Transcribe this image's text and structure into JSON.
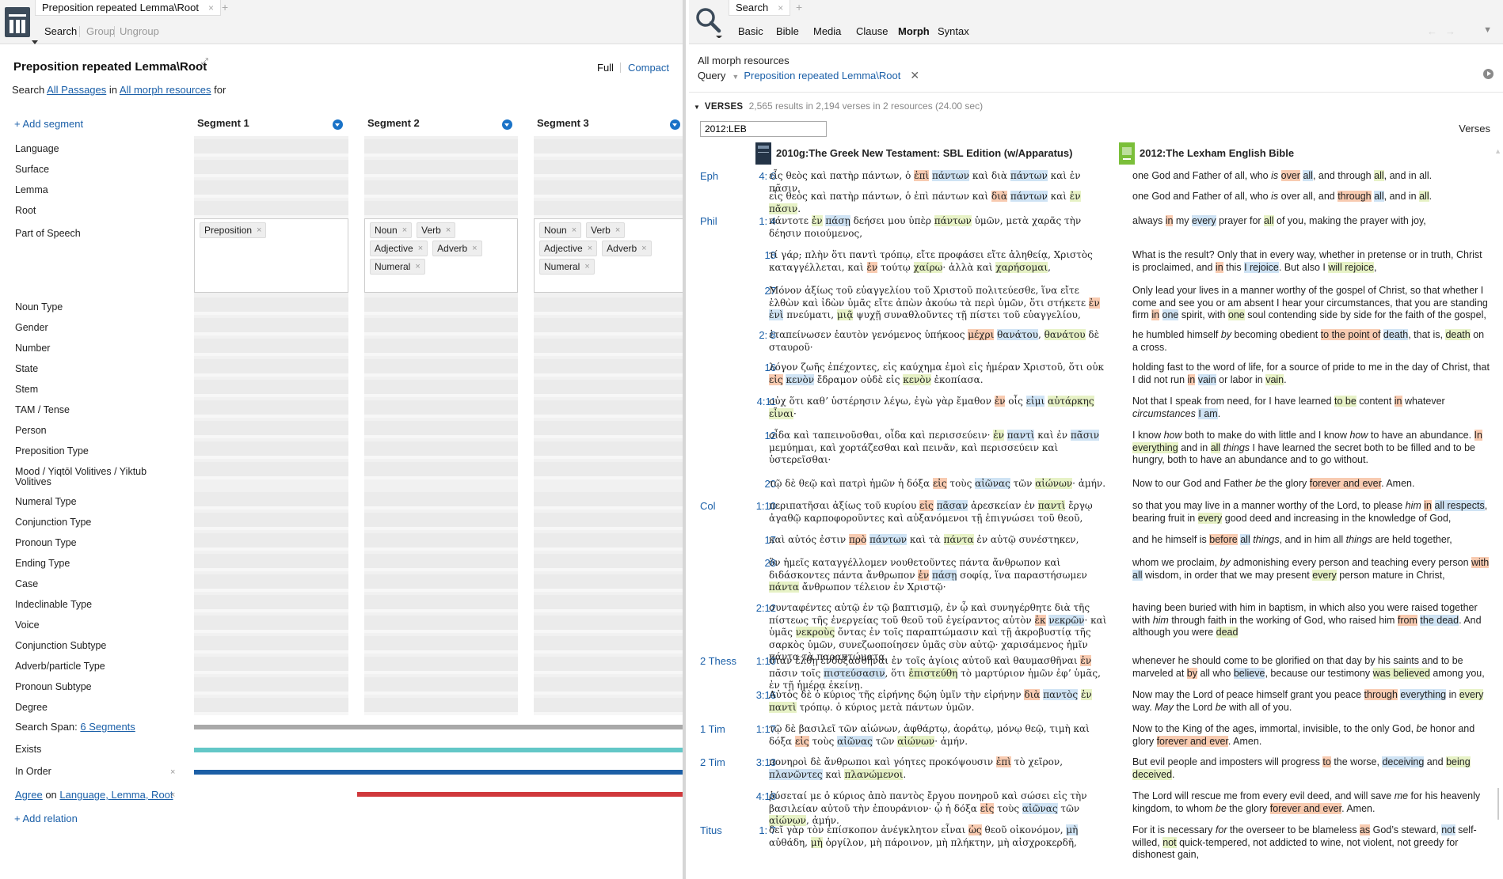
{
  "left": {
    "tab": {
      "title": "Preposition repeated Lemma\\Root",
      "close": "×",
      "plus": "+"
    },
    "toolbar": {
      "search": "Search",
      "group": "Group",
      "ungroup": "Ungroup"
    },
    "form": {
      "title": "Preposition repeated Lemma\\Root",
      "pin": "⤢",
      "view_full": "Full",
      "view_compact": "Compact",
      "search_word": "Search",
      "passages": "All Passages",
      "in_word": "in",
      "resources": "All morph resources",
      "for_word": "for",
      "add_segment": "+ Add segment"
    },
    "fields": [
      "Language",
      "Surface",
      "Lemma",
      "Root",
      "Part of Speech",
      "Noun Type",
      "Gender",
      "Number",
      "State",
      "Stem",
      "TAM / Tense",
      "Person",
      "Preposition Type",
      "Mood / Yiqtōl Volitives / Yiktub Volitives",
      "Numeral Type",
      "Conjunction Type",
      "Pronoun Type",
      "Ending Type",
      "Case",
      "Indeclinable Type",
      "Voice",
      "Conjunction Subtype",
      "Adverb/particle Type",
      "Pronoun Subtype",
      "Degree"
    ],
    "segments": [
      {
        "name": "Segment 1",
        "pos": [
          "Preposition"
        ]
      },
      {
        "name": "Segment 2",
        "pos": [
          "Noun",
          "Verb",
          "Adjective",
          "Adverb",
          "Numeral"
        ]
      },
      {
        "name": "Segment 3",
        "pos": [
          "Noun",
          "Verb",
          "Adjective",
          "Adverb",
          "Numeral"
        ]
      }
    ],
    "chip_x": "×",
    "relations": {
      "span_label": "Search Span:",
      "span_value": "6 Segments",
      "exists": "Exists",
      "in_order": "In Order",
      "agree": "Agree",
      "agree_on": "on",
      "agree_fields": "Language, Lemma, Root",
      "x": "×",
      "add_relation": "+ Add relation"
    },
    "colors": {
      "span": "#a9a9a9",
      "exists": "#63c7c7",
      "in_order": "#1c5fa6",
      "agree": "#d0393c"
    }
  },
  "right": {
    "tab": {
      "title": "Search",
      "close": "×",
      "plus": "+"
    },
    "tabs": [
      "Basic",
      "Bible",
      "Media",
      "Clause",
      "Morph",
      "Syntax"
    ],
    "active_tab": "Morph",
    "nav": {
      "back": "←",
      "forward": "→",
      "menu": "▼"
    },
    "scope": "All morph resources",
    "query_label": "Query",
    "query_dd": "▼",
    "query_name": "Preposition repeated Lemma\\Root",
    "query_x": "✕",
    "verses_tri": "▼",
    "verses_label": "VERSES",
    "results_meta": "2,565 results in 2,194 verses in 2 resources (24.00 sec)",
    "ref_input": "2012:LEB",
    "view_label": "Verses",
    "resources": [
      "2010g:The Greek New Testament: SBL Edition (w/Apparatus)",
      "2012:The Lexham English Bible"
    ],
    "rows": [
      {
        "book": "Eph",
        "ref": "4: 6",
        "gk": "εἷς θεὸς καὶ πατὴρ πάντων, ὁ [o:ἐπὶ] [b:πάντων] καὶ διὰ [b:πάντων] καὶ ἐν πᾶσιν.",
        "en": "one God and Father of all, who [i:is] [o:over] [b:all], and through [g:all], and in all."
      },
      {
        "book": "",
        "ref": "",
        "gk": "εἷς θεὸς καὶ πατὴρ πάντων, ὁ ἐπὶ πάντων καὶ [o:διὰ] [b:πάντων] καὶ [g:ἐν] [g:πᾶσιν].",
        "en": "one God and Father of all, who [i:is] over all, and [o:through] [b:all], and in [g:all]."
      },
      {
        "book": "Phil",
        "ref": "1: 4",
        "gk": "πάντοτε [g:ἐν] [b:πάσῃ] δεήσει μου ὑπὲρ [g:πάντων] ὑμῶν, μετὰ χαρᾶς τὴν δέησιν ποιούμενος,",
        "en": "always [o:in] my [b:every] prayer for [g:all] of you, making the prayer with joy,"
      },
      {
        "book": "",
        "ref": "18",
        "gk": "τί γάρ; πλὴν ὅτι παντὶ τρόπῳ, εἴτε προφάσει εἴτε ἀληθείᾳ, Χριστὸς καταγγέλλεται, καὶ [o:ἐν] τούτῳ [g:χαίρω]· ἀλλὰ καὶ [g:χαρήσομαι],",
        "en": "What is the result? Only that in every way, whether in pretense or in truth, Christ is proclaimed, and [o:in] this [b:I rejoice]. But also I [g:will rejoice],"
      },
      {
        "book": "",
        "ref": "27",
        "gk": "Μόνον ἀξίως τοῦ εὐαγγελίου τοῦ Χριστοῦ πολιτεύεσθε, ἵνα εἴτε ἐλθὼν καὶ ἰδὼν ὑμᾶς εἴτε ἀπὼν ἀκούω τὰ περὶ ὑμῶν, ὅτι στήκετε [o:ἐν] [b:ἑνὶ] πνεύματι, [g:μιᾷ] ψυχῇ συναθλοῦντες τῇ πίστει τοῦ εὐαγγελίου,",
        "en": "Only lead your lives in a manner worthy of the gospel of Christ, so that whether I come and see you or am absent I hear your circumstances, that you are standing firm [o:in] [b:one] spirit, with [g:one] soul contending side by side for the faith of the gospel,"
      },
      {
        "book": "",
        "ref": "2: 8",
        "gk": "ἐταπείνωσεν ἑαυτὸν γενόμενος ὑπήκοος [o:μέχρι] [b:θανάτου], [g:θανάτου] δὲ σταυροῦ·",
        "en": "he humbled himself [i:by] becoming obedient [o:to the point of] [b:death], that is, [g:death] on a cross."
      },
      {
        "book": "",
        "ref": "16",
        "gk": "λόγον ζωῆς ἐπέχοντες, εἰς καύχημα ἐμοὶ εἰς ἡμέραν Χριστοῦ, ὅτι οὐκ [o:εἰς] [b:κενὸν] ἔδραμον οὐδὲ εἰς [g:κενὸν] ἐκοπίασα.",
        "en": "holding fast to the word of life, for a source of pride to me in the day of Christ, that I did not run [o:in] [b:vain] or labor in [g:vain]."
      },
      {
        "book": "",
        "ref": "4:11",
        "gk": "οὐχ ὅτι καθʼ ὑστέρησιν λέγω, ἐγὼ γὰρ ἔμαθον [o:ἐν] οἷς [b:εἰμι] [g:αὐτάρκης] [g:εἶναι]·",
        "en": "Not that I speak from need, for I have learned [g:to be] content [o:in] whatever [i:circumstances] [b:I am]."
      },
      {
        "book": "",
        "ref": "12",
        "gk": "οἶδα καὶ ταπεινοῦσθαι, οἶδα καὶ περισσεύειν· [g:ἐν] [b:παντὶ] καὶ ἐν [b:πᾶσιν] μεμύημαι, καὶ χορτάζεσθαι καὶ πεινᾶν, καὶ περισσεύειν καὶ ὑστερεῖσθαι·",
        "en": "I know [i:how] both to make do with little and I know [i:how] to have an abundance. [o:In] [g:everything] and in [g:all] [i:things] I have learned the secret both to be filled and to be hungry, both to have an abundance and to go without."
      },
      {
        "book": "",
        "ref": "20",
        "gk": "τῷ δὲ θεῷ καὶ πατρὶ ἡμῶν ἡ δόξα [o:εἰς] τοὺς [b:αἰῶνας] τῶν [g:αἰώνων]· ἀμήν.",
        "en": "Now to our God and Father [i:be] the glory [o:forever and ever]. Amen."
      },
      {
        "book": "Col",
        "ref": "1:10",
        "gk": "περιπατῆσαι ἀξίως τοῦ κυρίου [o:εἰς] [b:πᾶσαν] ἀρεσκείαν ἐν [g:παντὶ] ἔργῳ ἀγαθῷ καρποφοροῦντες καὶ αὐξανόμενοι τῇ ἐπιγνώσει τοῦ θεοῦ,",
        "en": "so that you may live in a manner worthy of the Lord, to please [i:him] [o:in] [b:all respects], bearing fruit in [g:every] good deed and increasing in the knowledge of God,"
      },
      {
        "book": "",
        "ref": "17",
        "gk": "καὶ αὐτός ἐστιν [o:πρὸ] [b:πάντων] καὶ τὰ [g:πάντα] ἐν αὐτῷ συνέστηκεν,",
        "en": "and he himself is [o:before] [b:all] [i:things], and in him all [i:things] are held together,"
      },
      {
        "book": "",
        "ref": "28",
        "gk": "ὃν ἡμεῖς καταγγέλλομεν νουθετοῦντες πάντα ἄνθρωπον καὶ διδάσκοντες πάντα ἄνθρωπον [o:ἐν] [b:πάσῃ] σοφίᾳ, ἵνα παραστήσωμεν [g:πάντα] ἄνθρωπον τέλειον ἐν Χριστῷ·",
        "en": "whom we proclaim, [i:by] admonishing every person and teaching every person [o:with] [b:all] wisdom, in order that we may present [g:every] person mature in Christ,"
      },
      {
        "book": "",
        "ref": "2:12",
        "gk": "συνταφέντες αὐτῷ ἐν τῷ βαπτισμῷ, ἐν ᾧ καὶ συνηγέρθητε διὰ τῆς πίστεως τῆς ἐνεργείας τοῦ θεοῦ τοῦ ἐγείραντος αὐτὸν [o:ἐκ] [b:νεκρῶν]· καὶ ὑμᾶς [g:νεκροὺς] ὄντας ἐν τοῖς παραπτώμασιν καὶ τῇ ἀκροβυστίᾳ τῆς σαρκὸς ὑμῶν, συνεζωοποίησεν ὑμᾶς σὺν αὐτῷ· χαρισάμενος ἡμῖν πάντα τὰ παραπτώματα,",
        "en": "having been buried with him in baptism, in which also you were raised together with [i:him] through faith in the working of God, who raised him [o:from] [b:the dead]. And although you were [g:dead]"
      },
      {
        "book": "2 Thess",
        "ref": "1:10",
        "gk": "ὅταν ἔλθῃ ἐνδοξασθῆναι ἐν τοῖς ἁγίοις αὐτοῦ καὶ θαυμασθῆναι [o:ἐν] πᾶσιν τοῖς [b:πιστεύσασιν], ὅτι [g:ἐπιστεύθη] τὸ μαρτύριον ἡμῶν ἐφʼ ὑμᾶς, ἐν τῇ ἡμέρᾳ ἐκείνῃ.",
        "en": "whenever he should come to be glorified on that day by his saints and to be marveled at [o:by] all who [b:believe], because our testimony [g:was believed] among you,"
      },
      {
        "book": "",
        "ref": "3:16",
        "gk": "Αὐτὸς δὲ ὁ κύριος τῆς εἰρήνης δῴη ὑμῖν τὴν εἰρήνην [o:διὰ] [b:παντὸς] [g:ἐν] [g:παντὶ] τρόπῳ. ὁ κύριος μετὰ πάντων ὑμῶν.",
        "en": "Now may the Lord of peace himself grant you peace [o:through] [b:everything] in [g:every] way. [i:May] the Lord [i:be] with all of you."
      },
      {
        "book": "1 Tim",
        "ref": "1:17",
        "gk": "τῷ δὲ βασιλεῖ τῶν αἰώνων, ἀφθάρτῳ, ἀοράτῳ, μόνῳ θεῷ, τιμὴ καὶ δόξα [o:εἰς] τοὺς [b:αἰῶνας] τῶν [g:αἰώνων]· ἀμήν.",
        "en": "Now to the King of the ages, immortal, invisible, to the only God, [i:be] honor and glory [o:forever and ever]. Amen."
      },
      {
        "book": "2 Tim",
        "ref": "3:13",
        "gk": "πονηροὶ δὲ ἄνθρωποι καὶ γόητες προκόψουσιν [o:ἐπὶ] τὸ χεῖρον, [b:πλανῶντες] καὶ [g:πλανώμενοι].",
        "en": "But evil people and imposters will progress [o:to] the worse, [b:deceiving] and [g:being deceived]."
      },
      {
        "book": "",
        "ref": "4:18",
        "gk": "ῥύσεταί με ὁ κύριος ἀπὸ παντὸς ἔργου πονηροῦ καὶ σώσει εἰς τὴν βασιλείαν αὐτοῦ τὴν ἐπουράνιον· ᾧ ἡ δόξα [o:εἰς] τοὺς [b:αἰῶνας] τῶν [g:αἰώνων], ἀμήν.",
        "en": "The Lord will rescue me from every evil deed, and will save [i:me] for his heavenly kingdom, to whom [i:be] the glory [o:forever and ever]. Amen."
      },
      {
        "book": "Titus",
        "ref": "1: 7",
        "gk": "δεῖ γὰρ τὸν ἐπίσκοπον ἀνέγκλητον εἶναι [o:ὡς] θεοῦ οἰκονόμον, [b:μὴ] αὐθάδη, [g:μὴ] ὀργίλον, μὴ πάροινον, μὴ πλήκτην, μὴ αἰσχροκερδῆ,",
        "en": "For it is necessary [i:for] the overseer to be blameless [o:as] God’s steward, [b:not] self-willed, [g:not] quick-tempered, not addicted to wine, not violent, not greedy for dishonest gain,"
      }
    ]
  }
}
